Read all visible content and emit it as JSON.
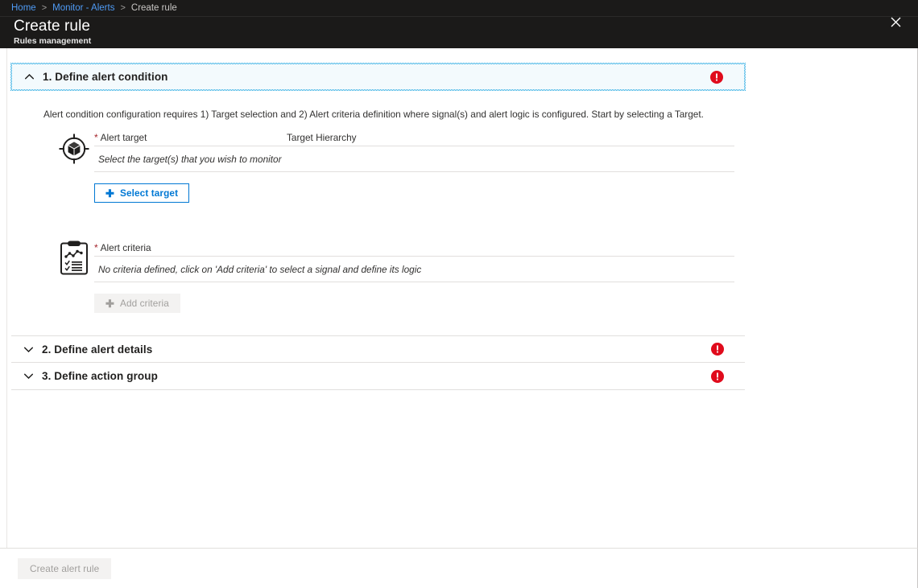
{
  "breadcrumb": {
    "items": [
      {
        "label": "Home",
        "link": true
      },
      {
        "label": "Monitor - Alerts",
        "link": true
      },
      {
        "label": "Create rule",
        "link": false
      }
    ],
    "separator": ">"
  },
  "header": {
    "title": "Create rule",
    "subtitle": "Rules management",
    "close_icon": "close-icon"
  },
  "colors": {
    "accent": "#0078d4",
    "error": "#e00b1c",
    "required": "#a4262c",
    "header_bg": "#1b1a19",
    "focus_outline": "#2aaae2",
    "section_bg": "#f3fafd"
  },
  "sections": [
    {
      "number": "1.",
      "title": "1. Define alert condition",
      "state": "expanded",
      "chevron": "chevron-up-icon",
      "has_error": true,
      "description": "Alert condition configuration requires 1) Target selection and 2) Alert criteria definition where signal(s) and alert logic is configured. Start by selecting a Target."
    },
    {
      "number": "2.",
      "title": "2. Define alert details",
      "state": "collapsed",
      "chevron": "chevron-down-icon",
      "has_error": true
    },
    {
      "number": "3.",
      "title": "3. Define action group",
      "state": "collapsed",
      "chevron": "chevron-down-icon",
      "has_error": true
    }
  ],
  "alert_target": {
    "icon": "target-resource-icon",
    "label": "Alert target",
    "required": true,
    "required_marker": "*",
    "hierarchy_label": "Target Hierarchy",
    "empty_text": "Select the target(s) that you wish to monitor",
    "button_label": "Select target",
    "button_icon": "plus-icon",
    "button_disabled": false
  },
  "alert_criteria": {
    "icon": "criteria-clipboard-icon",
    "label": "Alert criteria",
    "required": true,
    "required_marker": "*",
    "empty_text": "No criteria defined, click on 'Add criteria' to select a signal and define its logic",
    "button_label": "Add criteria",
    "button_icon": "plus-icon",
    "button_disabled": true
  },
  "footer": {
    "create_label": "Create alert rule",
    "create_disabled": true
  }
}
